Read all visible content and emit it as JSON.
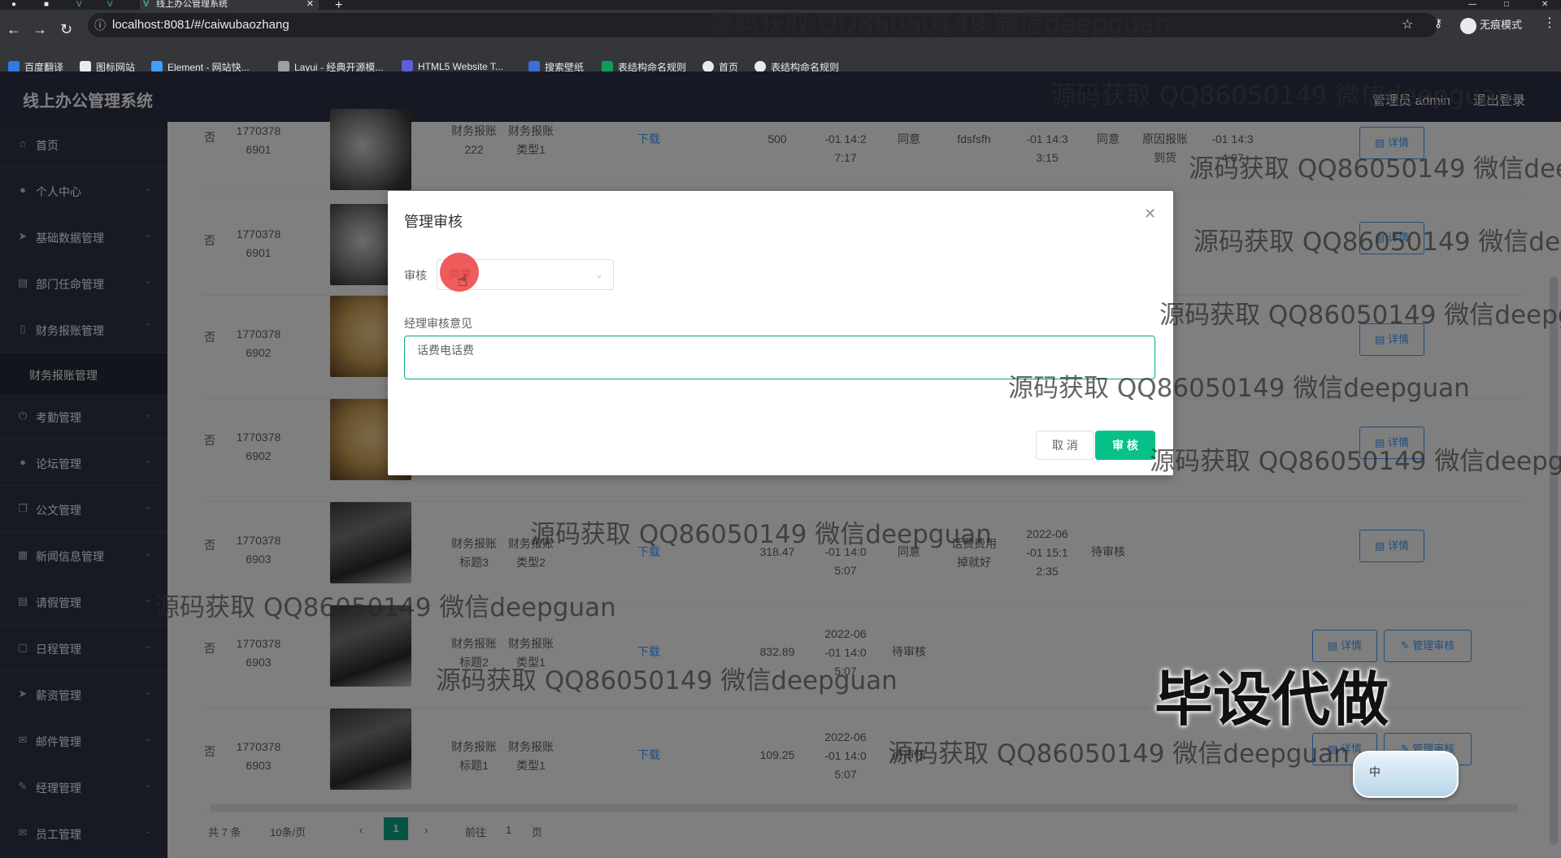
{
  "browser": {
    "tab_title": "线上办公管理系统",
    "url": "localhost:8081/#/caiwubaozhang",
    "incognito_label": "无痕模式",
    "bookmarks": [
      "百度翻译",
      "图标网站",
      "Element - 网站快...",
      "Layui - 经典开源模...",
      "HTML5 Website T...",
      "搜索壁纸",
      "表结构命名规则",
      "首页",
      "表结构命名规则"
    ]
  },
  "header": {
    "title": "线上办公管理系统",
    "admin_label": "管理员 admin",
    "logout_label": "退出登录"
  },
  "sidebar": {
    "items": [
      {
        "label": "首页",
        "icon": "home-icon"
      },
      {
        "label": "个人中心",
        "icon": "user-icon"
      },
      {
        "label": "基础数据管理",
        "icon": "send-icon"
      },
      {
        "label": "部门任命管理",
        "icon": "list-icon"
      },
      {
        "label": "财务报账管理",
        "icon": "phone-icon"
      },
      {
        "label": "考勤管理",
        "icon": "power-icon"
      },
      {
        "label": "论坛管理",
        "icon": "user-icon"
      },
      {
        "label": "公文管理",
        "icon": "copy-icon"
      },
      {
        "label": "新闻信息管理",
        "icon": "grid-icon"
      },
      {
        "label": "请假管理",
        "icon": "doc-icon"
      },
      {
        "label": "日程管理",
        "icon": "calendar-icon"
      },
      {
        "label": "薪资管理",
        "icon": "send-icon"
      },
      {
        "label": "邮件管理",
        "icon": "mail-icon"
      },
      {
        "label": "经理管理",
        "icon": "chat-icon"
      },
      {
        "label": "员工管理",
        "icon": "mail-icon"
      }
    ],
    "sub_item": "财务报账管理"
  },
  "table": {
    "rows": [
      {
        "col0": "否",
        "id_top": "1770378",
        "id_bottom": "6901",
        "title_top": "财务报账",
        "title_bottom": "222",
        "type_top": "财务报账",
        "type_bottom": "类型1",
        "download": "下载",
        "amount": "500",
        "date_a": "-01 14:2",
        "date_b": "7:17",
        "status1": "同意",
        "manager_note": "fdsfsfh",
        "date2_a": "-01 14:3",
        "date2_b": "3:15",
        "status2": "同意",
        "extra_a": "原因报账",
        "extra_b": "到货",
        "date3_a": "-01 14:3",
        "date3_b": "4:07",
        "detail": "详情"
      },
      {
        "col0": "否",
        "id_top": "1770378",
        "id_bottom": "6901",
        "detail": "详情"
      },
      {
        "col0": "否",
        "id_top": "1770378",
        "id_bottom": "6902",
        "detail": "详情"
      },
      {
        "col0": "否",
        "id_top": "1770378",
        "id_bottom": "6902",
        "detail": "详情"
      },
      {
        "col0": "否",
        "id_top": "1770378",
        "id_bottom": "6903",
        "title_top": "财务报账",
        "title_bottom": "标题3",
        "type_top": "财务报账",
        "type_bottom": "类型2",
        "download": "下载",
        "amount": "318.47",
        "date_a": "-01 14:0",
        "date_b": "5:07",
        "status1": "同意",
        "manager_note": "话费费用",
        "manager_note2": "掉就好",
        "date2_top": "2022-06",
        "date2_a": "-01 15:1",
        "date2_b": "2:35",
        "status2": "待审核",
        "detail": "详情"
      },
      {
        "col0": "否",
        "id_top": "1770378",
        "id_bottom": "6903",
        "title_top": "财务报账",
        "title_bottom": "标题2",
        "type_top": "财务报账",
        "type_bottom": "类型1",
        "download": "下载",
        "amount": "832.89",
        "date_top": "2022-06",
        "date_a": "-01 14:0",
        "date_b": "5:07",
        "status1": "待审核",
        "detail": "详情",
        "audit": "管理审核"
      },
      {
        "col0": "否",
        "id_top": "1770378",
        "id_bottom": "6903",
        "title_top": "财务报账",
        "title_bottom": "标题1",
        "type_top": "财务报账",
        "type_bottom": "类型1",
        "download": "下载",
        "amount": "109.25",
        "date_top": "2022-06",
        "date_a": "-01 14:0",
        "date_b": "5:07",
        "status1": "待审核",
        "detail": "详情",
        "audit": "管理审核"
      }
    ]
  },
  "pager": {
    "total": "共 7 条",
    "size": "10条/页",
    "current": "1",
    "goto": "前往",
    "goto_value": "1",
    "page_suffix": "页"
  },
  "dialog": {
    "title": "管理审核",
    "field1_label": "审核",
    "field1_value": "同意",
    "field2_label": "经理审核意见",
    "field2_value": "话费电话费",
    "cancel_label": "取 消",
    "submit_label": "审 核"
  },
  "watermarks": [
    "源码获取 QQ86050149 微信deepguan",
    "源码获取 QQ86050149 微信deepguan",
    "源码获取 QQ86050149 微信deep",
    "源码获取 QQ86050149 微信deep",
    "源码获取 QQ86050149 微信deepgu",
    "源码获取 QQ86050149 微信deepguan",
    "源码获取 QQ86050149 微信deepgua",
    "源码获取 QQ86050149 微信deepguan",
    "源码获取 QQ86050149 微信deepguan",
    "源码获取 QQ86050149 微信deepguan",
    "源码获取 QQ86050149 微信deepguan"
  ],
  "overlay_text": "毕设代做",
  "ime_label": "中",
  "colors": {
    "primary": "#409eff",
    "accent": "#07c08a",
    "sidebar": "#2f3347",
    "header": "#2d3047"
  }
}
